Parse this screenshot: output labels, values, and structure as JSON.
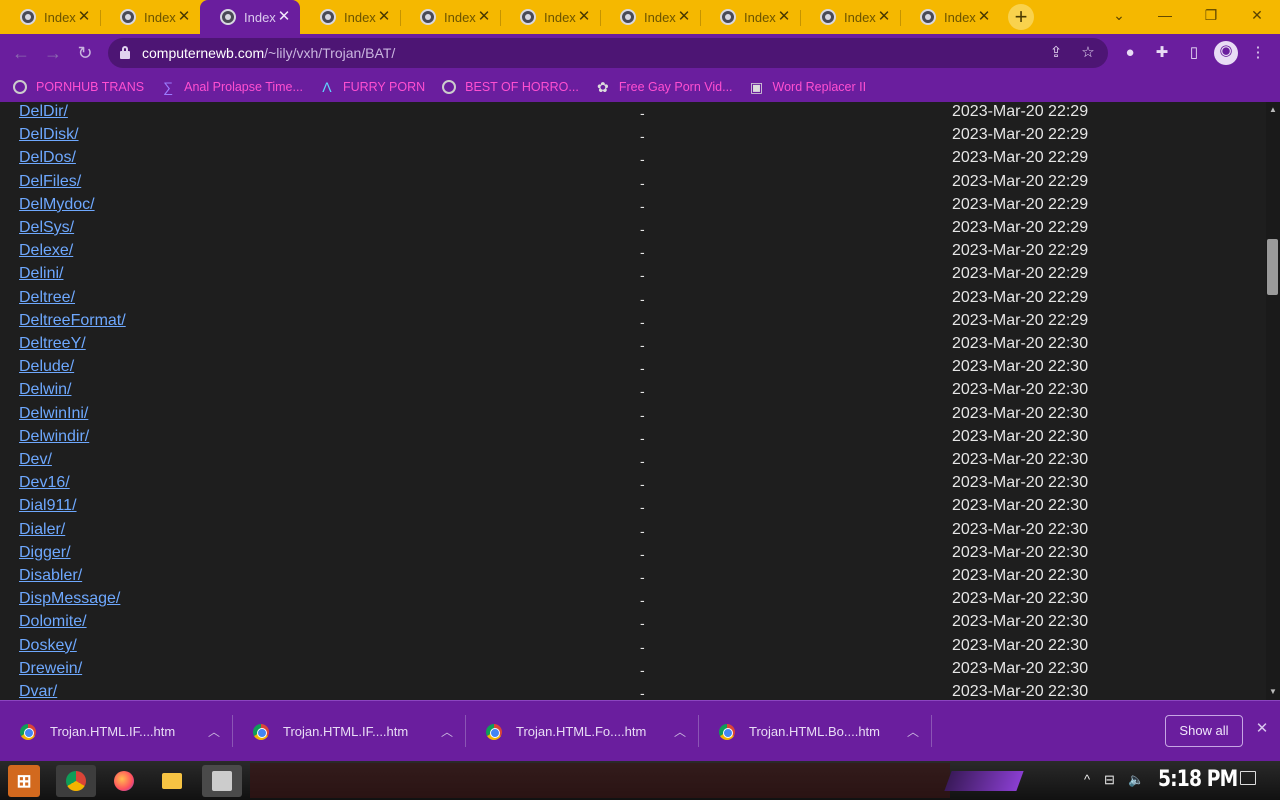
{
  "tabs": [
    {
      "title": "Index",
      "active": false
    },
    {
      "title": "Index",
      "active": false
    },
    {
      "title": "Index",
      "active": true
    },
    {
      "title": "Index",
      "active": false
    },
    {
      "title": "Index",
      "active": false
    },
    {
      "title": "Index",
      "active": false
    },
    {
      "title": "Index",
      "active": false
    },
    {
      "title": "Index",
      "active": false
    },
    {
      "title": "Index",
      "active": false
    },
    {
      "title": "Index",
      "active": false
    }
  ],
  "address": {
    "host": "computernewb.com",
    "path": "/~lily/vxh/Trojan/BAT/"
  },
  "bookmarks": [
    {
      "label": "PORNHUB TRANS",
      "icon": "globe-icon"
    },
    {
      "label": "Anal Prolapse Time...",
      "icon": "sigma-icon"
    },
    {
      "label": "FURRY PORN",
      "icon": "lambda-icon"
    },
    {
      "label": "BEST OF HORRO...",
      "icon": "globe-icon"
    },
    {
      "label": "Free Gay Porn Vid...",
      "icon": "site-icon"
    },
    {
      "label": "Word Replacer II",
      "icon": "wr-icon"
    }
  ],
  "listing": [
    {
      "name": "DelDir/",
      "size": "-",
      "date": "2023-Mar-20 22:29"
    },
    {
      "name": "DelDisk/",
      "size": "-",
      "date": "2023-Mar-20 22:29"
    },
    {
      "name": "DelDos/",
      "size": "-",
      "date": "2023-Mar-20 22:29"
    },
    {
      "name": "DelFiles/",
      "size": "-",
      "date": "2023-Mar-20 22:29"
    },
    {
      "name": "DelMydoc/",
      "size": "-",
      "date": "2023-Mar-20 22:29"
    },
    {
      "name": "DelSys/",
      "size": "-",
      "date": "2023-Mar-20 22:29"
    },
    {
      "name": "Delexe/",
      "size": "-",
      "date": "2023-Mar-20 22:29"
    },
    {
      "name": "Delini/",
      "size": "-",
      "date": "2023-Mar-20 22:29"
    },
    {
      "name": "Deltree/",
      "size": "-",
      "date": "2023-Mar-20 22:29"
    },
    {
      "name": "DeltreeFormat/",
      "size": "-",
      "date": "2023-Mar-20 22:29"
    },
    {
      "name": "DeltreeY/",
      "size": "-",
      "date": "2023-Mar-20 22:30"
    },
    {
      "name": "Delude/",
      "size": "-",
      "date": "2023-Mar-20 22:30"
    },
    {
      "name": "Delwin/",
      "size": "-",
      "date": "2023-Mar-20 22:30"
    },
    {
      "name": "DelwinIni/",
      "size": "-",
      "date": "2023-Mar-20 22:30"
    },
    {
      "name": "Delwindir/",
      "size": "-",
      "date": "2023-Mar-20 22:30"
    },
    {
      "name": "Dev/",
      "size": "-",
      "date": "2023-Mar-20 22:30"
    },
    {
      "name": "Dev16/",
      "size": "-",
      "date": "2023-Mar-20 22:30"
    },
    {
      "name": "Dial911/",
      "size": "-",
      "date": "2023-Mar-20 22:30"
    },
    {
      "name": "Dialer/",
      "size": "-",
      "date": "2023-Mar-20 22:30"
    },
    {
      "name": "Digger/",
      "size": "-",
      "date": "2023-Mar-20 22:30"
    },
    {
      "name": "Disabler/",
      "size": "-",
      "date": "2023-Mar-20 22:30"
    },
    {
      "name": "DispMessage/",
      "size": "-",
      "date": "2023-Mar-20 22:30"
    },
    {
      "name": "Dolomite/",
      "size": "-",
      "date": "2023-Mar-20 22:30"
    },
    {
      "name": "Doskey/",
      "size": "-",
      "date": "2023-Mar-20 22:30"
    },
    {
      "name": "Drewein/",
      "size": "-",
      "date": "2023-Mar-20 22:30"
    },
    {
      "name": "Dvar/",
      "size": "-",
      "date": "2023-Mar-20 22:30"
    }
  ],
  "downloads": [
    {
      "filename": "Trojan.HTML.IF....htm"
    },
    {
      "filename": "Trojan.HTML.IF....htm"
    },
    {
      "filename": "Trojan.HTML.Fo....htm"
    },
    {
      "filename": "Trojan.HTML.Bo....htm"
    }
  ],
  "downloads_bar": {
    "show_all": "Show all"
  },
  "taskbar": {
    "clock": "5:18 PM"
  },
  "colors": {
    "theme_purple": "#6a1e9e",
    "tabstrip_yellow": "#f5b800",
    "link_blue": "#6ea8fe",
    "bookmark_pink": "#ff4fd1"
  }
}
